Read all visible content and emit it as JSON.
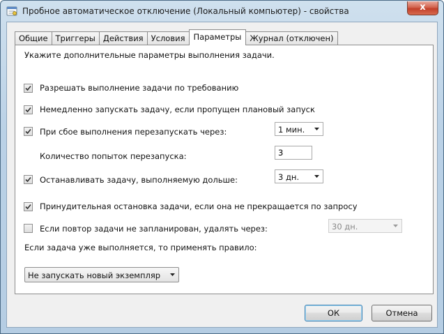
{
  "window": {
    "title": "Пробное автоматическое отключение (Локальный компьютер) - свойства",
    "close_label": "x",
    "icon": "task-icon"
  },
  "tabs": [
    {
      "label": "Общие",
      "active": false
    },
    {
      "label": "Триггеры",
      "active": false
    },
    {
      "label": "Действия",
      "active": false
    },
    {
      "label": "Условия",
      "active": false
    },
    {
      "label": "Параметры",
      "active": true
    },
    {
      "label": "Журнал (отключен)",
      "active": false
    }
  ],
  "settings": {
    "intro": "Укажите дополнительные параметры выполнения задачи.",
    "allow_on_demand": {
      "label": "Разрешать выполнение задачи по требованию",
      "checked": true
    },
    "run_asap_missed": {
      "label": "Немедленно запускать задачу, если пропущен плановый запуск",
      "checked": true
    },
    "restart_on_fail": {
      "label": "При сбое выполнения перезапускать через:",
      "checked": true,
      "value": "1 мин."
    },
    "restart_attempts": {
      "label": "Количество попыток перезапуска:",
      "value": "3"
    },
    "stop_if_longer": {
      "label": "Останавливать задачу, выполняемую дольше:",
      "checked": true,
      "value": "3 дн."
    },
    "force_stop": {
      "label": "Принудительная остановка задачи, если она не прекращается по запросу",
      "checked": true
    },
    "delete_if_not_scheduled": {
      "label": "Если повтор задачи не запланирован, удалять через:",
      "checked": false,
      "value": "30 дн."
    },
    "rule_label": "Если задача уже выполняется, то применять правило:",
    "rule_value": "Не запускать новый экземпляр"
  },
  "buttons": {
    "ok": "ОК",
    "cancel": "Отмена"
  }
}
